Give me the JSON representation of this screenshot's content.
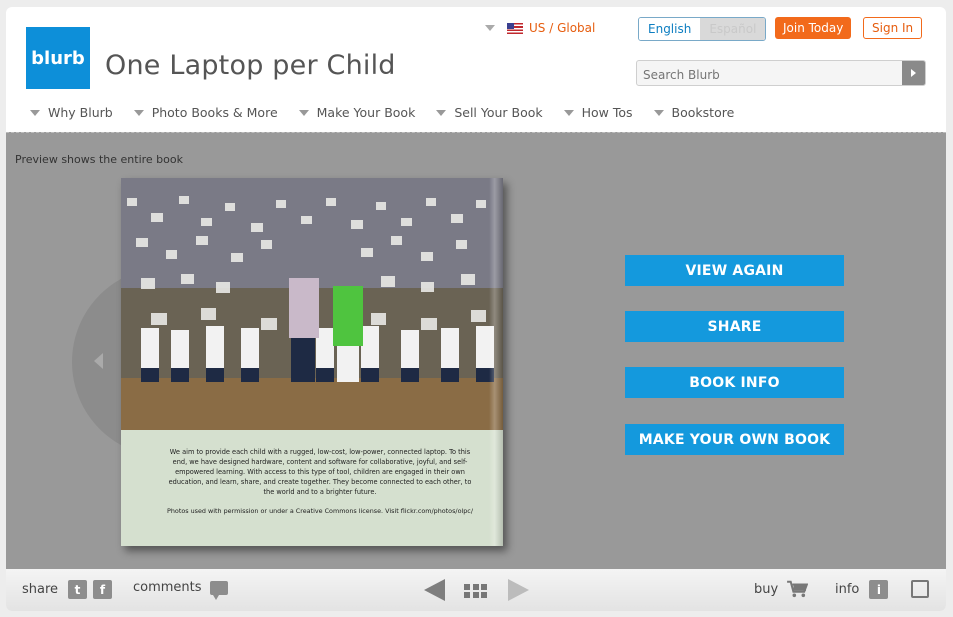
{
  "header": {
    "logo_text": "blurb",
    "title": "One Laptop per Child",
    "region_label": "US / Global",
    "lang_english": "English",
    "lang_spanish": "Español",
    "join_label": "Join Today",
    "signin_label": "Sign In",
    "search_placeholder": "Search Blurb"
  },
  "nav": {
    "items": [
      {
        "label": "Why Blurb"
      },
      {
        "label": "Photo Books & More"
      },
      {
        "label": "Make Your Book"
      },
      {
        "label": "Sell Your Book"
      },
      {
        "label": "How Tos"
      },
      {
        "label": "Bookstore"
      }
    ]
  },
  "viewer": {
    "preview_note": "Preview shows the entire book",
    "book_caption": "We aim to provide each child with a rugged, low-cost, low-power, connected laptop. To this end, we have designed hardware, content and software for collaborative, joyful, and self-empowered learning. With access to this type of tool, children are engaged in their own education, and learn, share, and create together. They become connected to each other, to the world and to a brighter future.",
    "book_credit": "Photos used with permission or under a Creative Commons license. Visit flickr.com/photos/olpc/",
    "actions": [
      "VIEW AGAIN",
      "SHARE",
      "BOOK INFO",
      "MAKE YOUR OWN BOOK"
    ]
  },
  "toolbar": {
    "share_label": "share",
    "twitter_glyph": "t",
    "facebook_glyph": "f",
    "comments_label": "comments",
    "buy_label": "buy",
    "info_label": "info",
    "info_glyph": "i"
  },
  "colors": {
    "brand_blue": "#0d8fd9",
    "accent_orange": "#f26a1b",
    "action_blue": "#1499dd"
  },
  "icons": [
    "chevron-down-icon",
    "us-flag-icon",
    "search-go-icon",
    "prev-page-icon",
    "twitter-icon",
    "facebook-icon",
    "comment-icon",
    "grid-view-icon",
    "next-page-icon",
    "cart-icon",
    "info-icon",
    "fullscreen-icon"
  ]
}
